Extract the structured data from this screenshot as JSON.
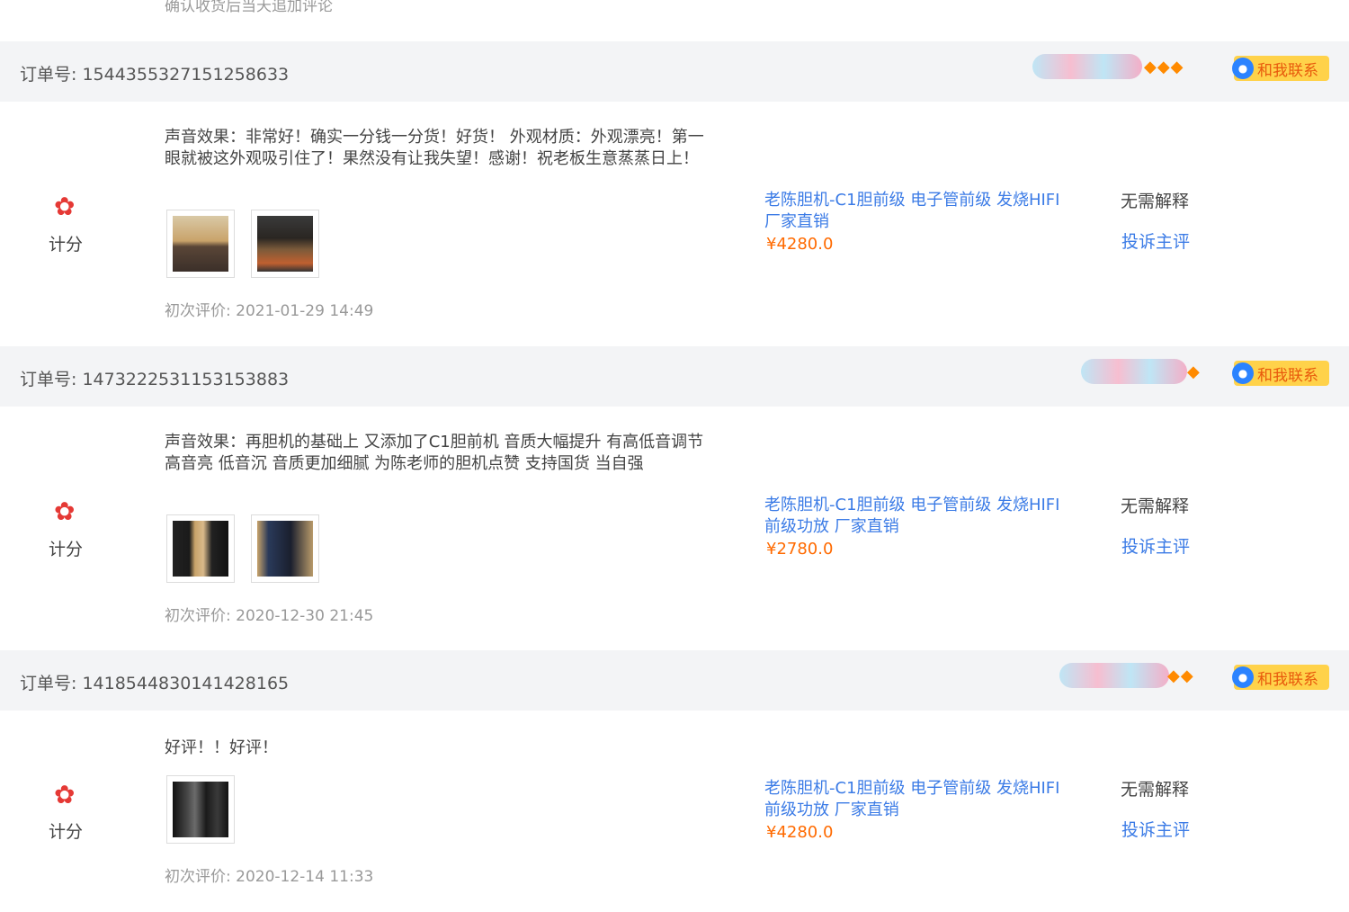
{
  "top_note": "确认收货后当天追加评论",
  "labels": {
    "score": "计分",
    "no_explain": "无需解释",
    "complain": "投诉主评",
    "contact": "和我联系"
  },
  "orders": [
    {
      "order_no": "订单号: 1544355327151258633",
      "diamonds": "◆◆◆",
      "review": "声音效果：非常好！确实一分钱一分货！好货！ 外观材质：外观漂亮！第一眼就被这外观吸引住了！果然没有让我失望！感谢！祝老板生意蒸蒸日上！",
      "review_time": "初次评价: 2021-01-29 14:49",
      "product": "老陈胆机-C1胆前级 电子管前级 发烧HIFI 厂家直销",
      "price": "¥4280.0"
    },
    {
      "order_no": "订单号: 1473222531153153883",
      "diamonds": "◆",
      "review": "声音效果：再胆机的基础上 又添加了C1胆前机 音质大幅提升 有高低音调节 高音亮 低音沉 音质更加细腻 为陈老师的胆机点赞 支持国货 当自强",
      "review_time": "初次评价: 2020-12-30 21:45",
      "product": "老陈胆机-C1胆前级 电子管前级 发烧HIFI 前级功放 厂家直销",
      "price": "¥2780.0"
    },
    {
      "order_no": "订单号: 1418544830141428165",
      "diamonds": "◆◆",
      "review": "好评！！好评！",
      "review_time": "初次评价: 2020-12-14 11:33",
      "product": "老陈胆机-C1胆前级 电子管前级 发烧HIFI 前级功放 厂家直销",
      "price": "¥4280.0"
    }
  ],
  "colors": {
    "link": "#3b7be6",
    "price": "#ff6a00",
    "header_bg": "#f3f4f6",
    "contact_bg": "#ffd24a"
  }
}
